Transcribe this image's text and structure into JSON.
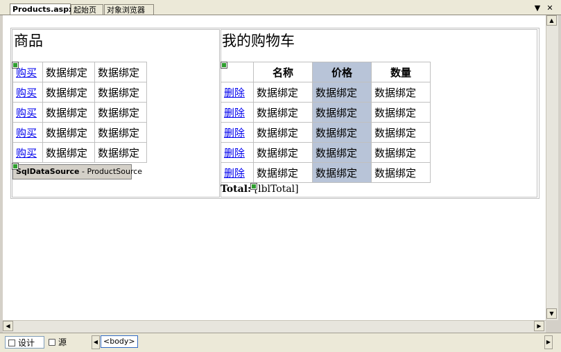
{
  "tabs": [
    {
      "label": "Products.aspx",
      "active": true
    },
    {
      "label": "起始页",
      "active": false
    },
    {
      "label": "对象浏览器",
      "active": false
    }
  ],
  "tab_controls": {
    "dropdown": "▼",
    "close": "✕"
  },
  "products": {
    "heading": "商品",
    "rows": [
      {
        "action": "购买",
        "c1": "数据绑定",
        "c2": "数据绑定"
      },
      {
        "action": "购买",
        "c1": "数据绑定",
        "c2": "数据绑定"
      },
      {
        "action": "购买",
        "c1": "数据绑定",
        "c2": "数据绑定"
      },
      {
        "action": "购买",
        "c1": "数据绑定",
        "c2": "数据绑定"
      },
      {
        "action": "购买",
        "c1": "数据绑定",
        "c2": "数据绑定"
      }
    ]
  },
  "datasource": {
    "type": "SqlDataSource",
    "separator": " - ",
    "id": "ProductSource"
  },
  "cart": {
    "heading": "我的购物车",
    "headers": [
      "",
      "名称",
      "价格",
      "数量"
    ],
    "rows": [
      {
        "action": "删除",
        "name": "数据绑定",
        "price": "数据绑定",
        "qty": "数据绑定"
      },
      {
        "action": "删除",
        "name": "数据绑定",
        "price": "数据绑定",
        "qty": "数据绑定"
      },
      {
        "action": "删除",
        "name": "数据绑定",
        "price": "数据绑定",
        "qty": "数据绑定"
      },
      {
        "action": "删除",
        "name": "数据绑定",
        "price": "数据绑定",
        "qty": "数据绑定"
      },
      {
        "action": "删除",
        "name": "数据绑定",
        "price": "数据绑定",
        "qty": "数据绑定"
      }
    ],
    "highlight_color": "#b8c4d8"
  },
  "total": {
    "label": "Total:",
    "value": "[lblTotal]"
  },
  "statusbar": {
    "design_label": "设计",
    "source_label": "源",
    "tag": "<body>"
  }
}
